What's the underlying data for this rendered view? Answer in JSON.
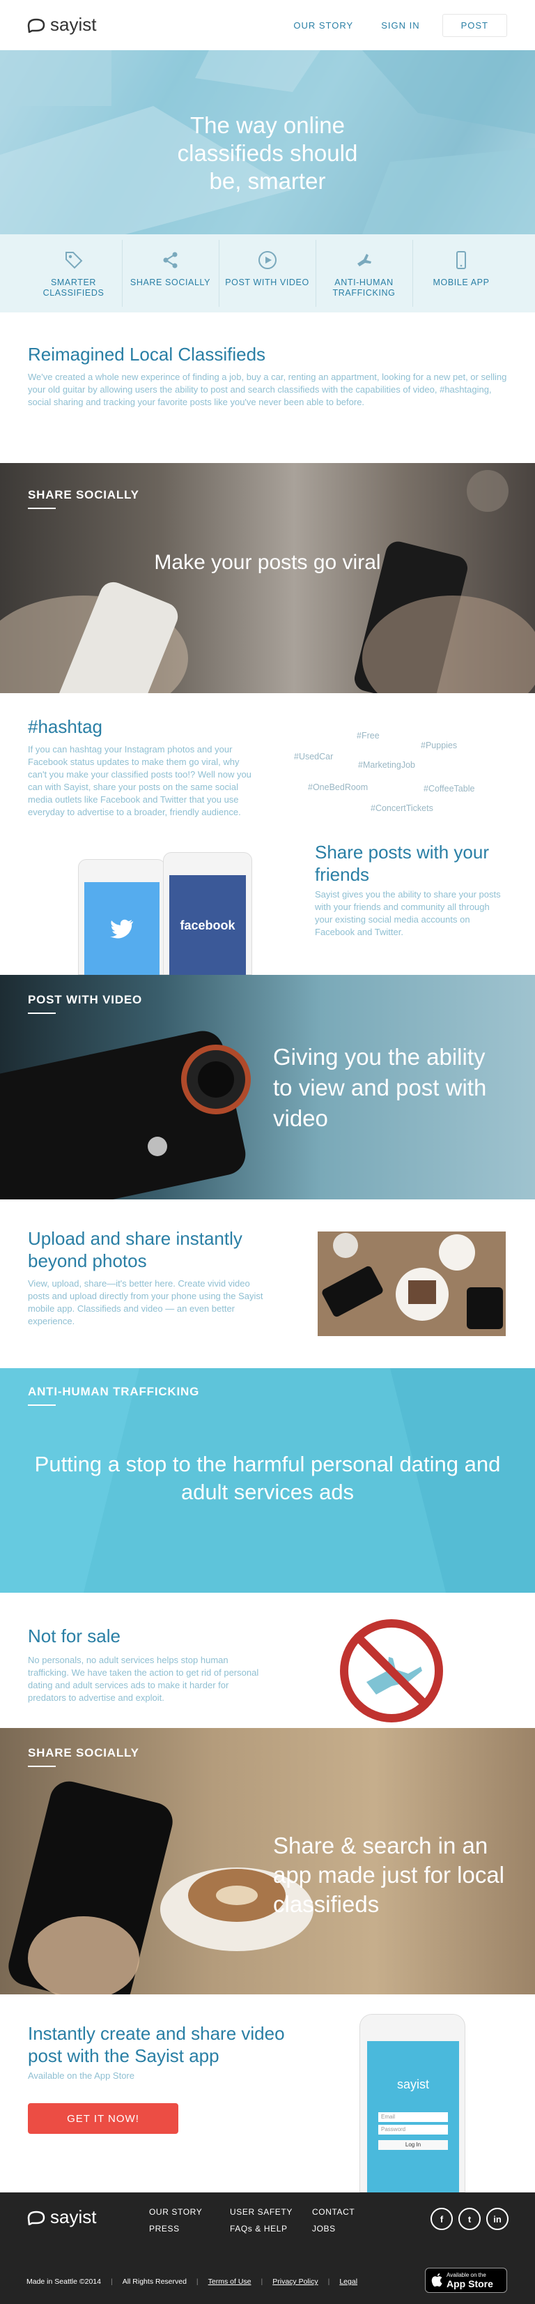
{
  "brand": {
    "name": "sayist"
  },
  "nav": {
    "items": [
      "OUR STORY",
      "SIGN IN"
    ],
    "post": "POST"
  },
  "hero": {
    "title": "The way online classifieds should be, smarter"
  },
  "features": [
    {
      "icon": "tag-icon",
      "label": "SMARTER CLASSIFIEDS"
    },
    {
      "icon": "share-icon",
      "label": "SHARE SOCIALLY"
    },
    {
      "icon": "play-icon",
      "label": "POST WITH VIDEO"
    },
    {
      "icon": "no-trafficking-icon",
      "label": "ANTI-HUMAN TRAFFICKING"
    },
    {
      "icon": "mobile-icon",
      "label": "MOBILE APP"
    }
  ],
  "reimagined": {
    "title": "Reimagined Local Classifieds",
    "body": "We've created a whole new experince of finding a job, buy a car, renting an appartment, looking for a new pet, or selling your old guitar by allowing users the ability to post and search classifieds with the capabilities of video, #hashtaging, social sharing and tracking your favorite posts like you've never been able to before."
  },
  "share_socially": {
    "label": "SHARE SOCIALLY",
    "title": "Make your posts go viral"
  },
  "hashtag": {
    "title": "#hashtag",
    "body": "If you can hashtag your Instagram photos and your Facebook status updates to make them go viral, why can't you make your classified posts too!? Well now you can with Sayist, share your posts on the same social media outlets like Facebook and Twitter that you use everyday to advertise to a broader, friendly audience.",
    "tags": [
      "#Free",
      "#Puppies",
      "#UsedCar",
      "#MarketingJob",
      "#OneBedRoom",
      "#CoffeeTable",
      "#ConcertTickets"
    ]
  },
  "share_posts": {
    "title": "Share posts with your friends",
    "body": "Sayist gives you the ability to share your posts with your friends and community all through your existing social media accounts on Facebook and Twitter.",
    "phone_left": "twitter",
    "phone_right": "facebook"
  },
  "post_video": {
    "label": "POST WITH VIDEO",
    "title": "Giving you the ability to view and post with video"
  },
  "upload": {
    "title": "Upload and share instantly beyond photos",
    "body": "View, upload, share—it's better here. Create vivid video posts and upload directly from your phone using the Sayist mobile app. Classifieds and video — an even better experience."
  },
  "anti": {
    "label": "ANTI-HUMAN TRAFFICKING",
    "title": "Putting a stop to the harmful personal dating and adult services ads"
  },
  "not_for_sale": {
    "title": "Not for sale",
    "body": "No personals, no adult services helps stop human trafficking. We have taken the action to get rid of personal dating and adult services ads to make it harder for predators to advertise and exploit."
  },
  "share_search": {
    "label": "SHARE SOCIALLY",
    "title": "Share & search in an app made just for local classifieds"
  },
  "app": {
    "title": "Instantly create and share video post with the Sayist app",
    "subtitle": "Available on the App Store",
    "button": "GET IT NOW!",
    "phone_brand": "sayist",
    "phone_email": "Email",
    "phone_password": "Password",
    "phone_login": "Log In"
  },
  "footer": {
    "col1": [
      "OUR STORY",
      "PRESS"
    ],
    "col2": [
      "USER SAFETY",
      "FAQs & HELP"
    ],
    "col3": [
      "CONTACT",
      "JOBS"
    ],
    "bottom": {
      "made": "Made in Seattle ©2014",
      "rights": "All Rights Reserved",
      "terms": "Terms of Use",
      "privacy": "Privacy Policy",
      "legal": "Legal"
    },
    "appstore": {
      "small": "Available on the",
      "big": "App Store"
    }
  },
  "colors": {
    "blue": "#2a7fa5",
    "light_text": "#8fbfd2",
    "red": "#ec4d44",
    "footer": "#242424"
  }
}
